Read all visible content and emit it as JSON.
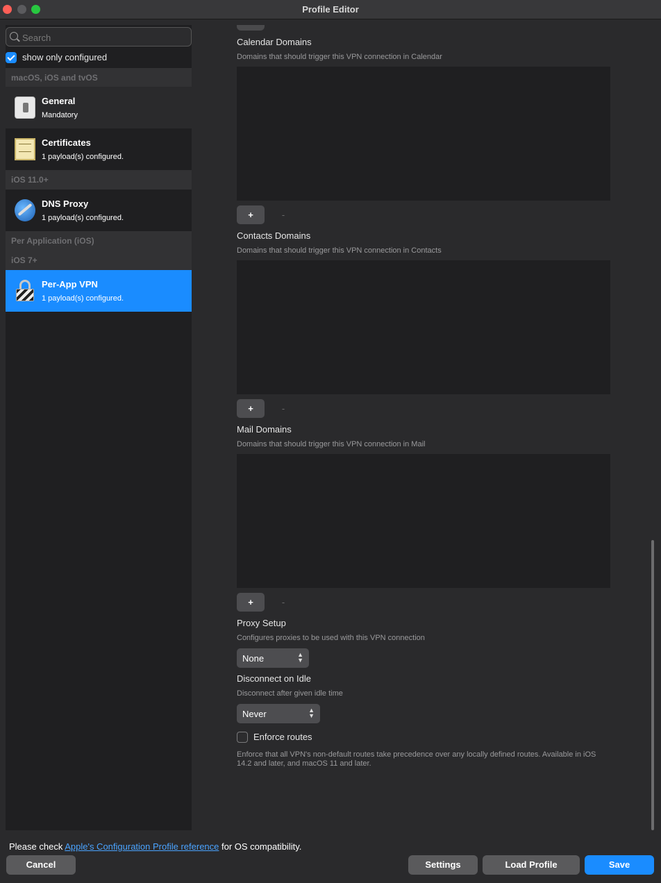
{
  "window": {
    "title": "Profile Editor"
  },
  "sidebar": {
    "search_placeholder": "Search",
    "show_only_configured_label": "show only configured",
    "show_only_configured_checked": true,
    "sections": [
      {
        "label": "macOS, iOS and tvOS"
      },
      {
        "label": "iOS 11.0+"
      },
      {
        "label": "Per Application (iOS)"
      },
      {
        "label": "iOS 7+"
      }
    ],
    "items": [
      {
        "title": "General",
        "subtitle": "Mandatory",
        "icon": "switch-icon"
      },
      {
        "title": "Certificates",
        "subtitle": "1 payload(s) configured.",
        "icon": "certificate-icon"
      },
      {
        "title": "DNS Proxy",
        "subtitle": "1 payload(s) configured.",
        "icon": "globe-wrench-icon"
      },
      {
        "title": "Per-App VPN",
        "subtitle": "1 payload(s) configured.",
        "icon": "lock-icon",
        "selected": true
      }
    ]
  },
  "main": {
    "calendar": {
      "title": "Calendar Domains",
      "desc": "Domains that should trigger this VPN connection in Calendar"
    },
    "contacts": {
      "title": "Contacts Domains",
      "desc": "Domains that should trigger this VPN connection in Contacts"
    },
    "mail": {
      "title": "Mail Domains",
      "desc": "Domains that should trigger this VPN connection in Mail"
    },
    "add_label": "+",
    "remove_label": "-",
    "proxy": {
      "title": "Proxy Setup",
      "desc": "Configures proxies to be used with this VPN connection",
      "value": "None"
    },
    "idle": {
      "title": "Disconnect on Idle",
      "desc": "Disconnect after given idle time",
      "value": "Never"
    },
    "enforce": {
      "label": "Enforce routes",
      "checked": false,
      "desc": "Enforce that all VPN's non-default routes take precedence over any locally defined routes. Available in iOS 14.2 and later, and macOS 11 and later."
    }
  },
  "footer": {
    "text_before": "Please check ",
    "link": "Apple's Configuration Profile reference",
    "text_after": " for OS compatibility.",
    "cancel": "Cancel",
    "settings": "Settings",
    "load_profile": "Load Profile",
    "save": "Save"
  },
  "colors": {
    "accent": "#1a8cff",
    "background": "#2a2a2c",
    "sidebar": "#1f1f21"
  }
}
